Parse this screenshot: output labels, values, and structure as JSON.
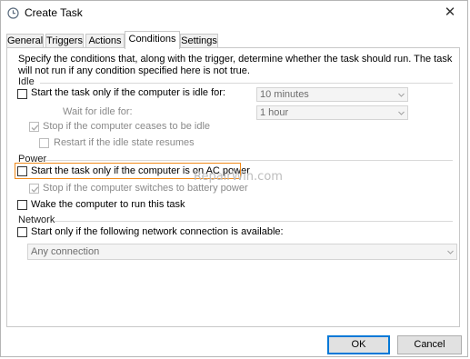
{
  "window": {
    "title": "Create Task",
    "app_icon": "clock-icon",
    "close_icon": "close-icon"
  },
  "tabs": [
    {
      "label": "General",
      "active": false
    },
    {
      "label": "Triggers",
      "active": false
    },
    {
      "label": "Actions",
      "active": false
    },
    {
      "label": "Conditions",
      "active": true
    },
    {
      "label": "Settings",
      "active": false
    }
  ],
  "description": "Specify the conditions that, along with the trigger, determine whether the task should run.  The task will not run  if any condition specified here is not true.",
  "idle": {
    "heading": "Idle",
    "start_if_idle": {
      "label": "Start the task only if the computer is idle for:",
      "checked": false,
      "enabled": true
    },
    "idle_for_value": "10 minutes",
    "wait_label": "Wait for idle for:",
    "wait_value": "1 hour",
    "stop_if_not_idle": {
      "label": "Stop if the computer ceases to be idle",
      "checked": true,
      "enabled": false
    },
    "restart_if_idle": {
      "label": "Restart if the idle state resumes",
      "checked": false,
      "enabled": false
    }
  },
  "power": {
    "heading": "Power",
    "start_on_ac": {
      "label": "Start the task only if the computer is on AC power",
      "checked": false,
      "enabled": true
    },
    "stop_on_battery": {
      "label": "Stop if the computer switches to battery power",
      "checked": true,
      "enabled": false
    },
    "wake": {
      "label": "Wake the computer to run this task",
      "checked": false,
      "enabled": true
    }
  },
  "network": {
    "heading": "Network",
    "start_if_network": {
      "label": "Start only if the following network connection is available:",
      "checked": false,
      "enabled": true
    },
    "connection_value": "Any connection"
  },
  "watermark": "RepairWin.com",
  "buttons": {
    "ok": "OK",
    "cancel": "Cancel"
  },
  "colors": {
    "highlight": "#f18a1a",
    "default_button_border": "#0078d7"
  }
}
